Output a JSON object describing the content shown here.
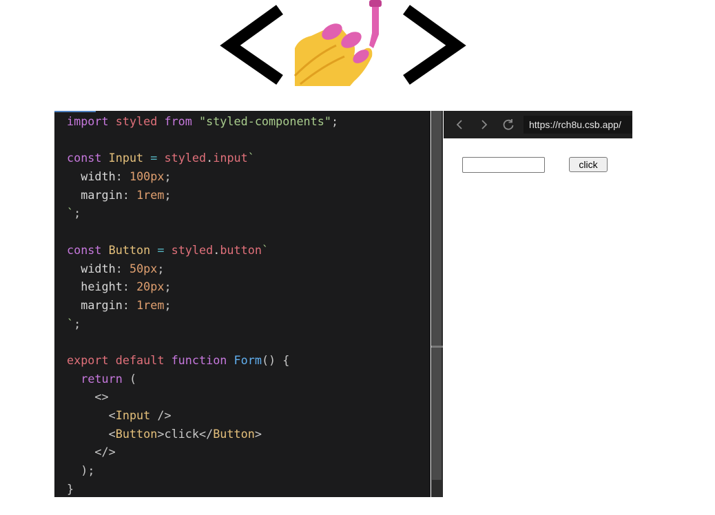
{
  "header": {
    "logo_left_glyph": "<",
    "logo_right_glyph": ">",
    "logo_icon": "nail-polish-icon"
  },
  "editor": {
    "lines": [
      [
        {
          "t": "import",
          "c": "kw"
        },
        {
          "t": " "
        },
        {
          "t": "styled",
          "c": "kw2"
        },
        {
          "t": " "
        },
        {
          "t": "from",
          "c": "kw"
        },
        {
          "t": " "
        },
        {
          "t": "\"styled-components\"",
          "c": "str"
        },
        {
          "t": ";",
          "c": "punc"
        }
      ],
      [],
      [
        {
          "t": "const",
          "c": "kw"
        },
        {
          "t": " "
        },
        {
          "t": "Input",
          "c": "id"
        },
        {
          "t": " "
        },
        {
          "t": "=",
          "c": "op"
        },
        {
          "t": " "
        },
        {
          "t": "styled",
          "c": "kw2"
        },
        {
          "t": "."
        },
        {
          "t": "input",
          "c": "kw2"
        },
        {
          "t": "`",
          "c": "str"
        }
      ],
      [
        {
          "t": "  "
        },
        {
          "t": "width",
          "c": "prop"
        },
        {
          "t": ": ",
          "c": "punc"
        },
        {
          "t": "100px",
          "c": "num"
        },
        {
          "t": ";",
          "c": "punc"
        }
      ],
      [
        {
          "t": "  "
        },
        {
          "t": "margin",
          "c": "prop"
        },
        {
          "t": ": ",
          "c": "punc"
        },
        {
          "t": "1rem",
          "c": "num"
        },
        {
          "t": ";",
          "c": "punc"
        }
      ],
      [
        {
          "t": "`",
          "c": "str"
        },
        {
          "t": ";",
          "c": "punc"
        }
      ],
      [],
      [
        {
          "t": "const",
          "c": "kw"
        },
        {
          "t": " "
        },
        {
          "t": "Button",
          "c": "id"
        },
        {
          "t": " "
        },
        {
          "t": "=",
          "c": "op"
        },
        {
          "t": " "
        },
        {
          "t": "styled",
          "c": "kw2"
        },
        {
          "t": "."
        },
        {
          "t": "button",
          "c": "kw2"
        },
        {
          "t": "`",
          "c": "str"
        }
      ],
      [
        {
          "t": "  "
        },
        {
          "t": "width",
          "c": "prop"
        },
        {
          "t": ": ",
          "c": "punc"
        },
        {
          "t": "50px",
          "c": "num"
        },
        {
          "t": ";",
          "c": "punc"
        }
      ],
      [
        {
          "t": "  "
        },
        {
          "t": "height",
          "c": "prop"
        },
        {
          "t": ": ",
          "c": "punc"
        },
        {
          "t": "20px",
          "c": "num"
        },
        {
          "t": ";",
          "c": "punc"
        }
      ],
      [
        {
          "t": "  "
        },
        {
          "t": "margin",
          "c": "prop"
        },
        {
          "t": ": ",
          "c": "punc"
        },
        {
          "t": "1rem",
          "c": "num"
        },
        {
          "t": ";",
          "c": "punc"
        }
      ],
      [
        {
          "t": "`",
          "c": "str"
        },
        {
          "t": ";",
          "c": "punc"
        }
      ],
      [],
      [
        {
          "t": "export",
          "c": "kw2"
        },
        {
          "t": " "
        },
        {
          "t": "default",
          "c": "kw2"
        },
        {
          "t": " "
        },
        {
          "t": "function",
          "c": "kw"
        },
        {
          "t": " "
        },
        {
          "t": "Form",
          "c": "fn"
        },
        {
          "t": "() {",
          "c": "punc"
        }
      ],
      [
        {
          "t": "  "
        },
        {
          "t": "return",
          "c": "kw"
        },
        {
          "t": " (",
          "c": "punc"
        }
      ],
      [
        {
          "t": "    "
        },
        {
          "t": "<>",
          "c": "punc"
        }
      ],
      [
        {
          "t": "      "
        },
        {
          "t": "<",
          "c": "punc"
        },
        {
          "t": "Input",
          "c": "tag"
        },
        {
          "t": " />",
          "c": "punc"
        }
      ],
      [
        {
          "t": "      "
        },
        {
          "t": "<",
          "c": "punc"
        },
        {
          "t": "Button",
          "c": "tag"
        },
        {
          "t": ">click</",
          "c": "punc"
        },
        {
          "t": "Button",
          "c": "tag"
        },
        {
          "t": ">",
          "c": "punc"
        }
      ],
      [
        {
          "t": "    "
        },
        {
          "t": "</>",
          "c": "punc"
        }
      ],
      [
        {
          "t": "  "
        },
        {
          "t": ");",
          "c": "punc"
        }
      ],
      [
        {
          "t": "}",
          "c": "punc"
        }
      ]
    ]
  },
  "browser": {
    "back_icon": "chevron-left-icon",
    "forward_icon": "chevron-right-icon",
    "reload_icon": "reload-icon",
    "url": "https://rch8u.csb.app/"
  },
  "preview": {
    "input_value": "",
    "button_label": "click"
  },
  "colors": {
    "editor_bg": "#1b1b1c",
    "browser_bar_bg": "#1f1f1f",
    "nail_polish": "#e060b0",
    "hand": "#f5c33b"
  }
}
